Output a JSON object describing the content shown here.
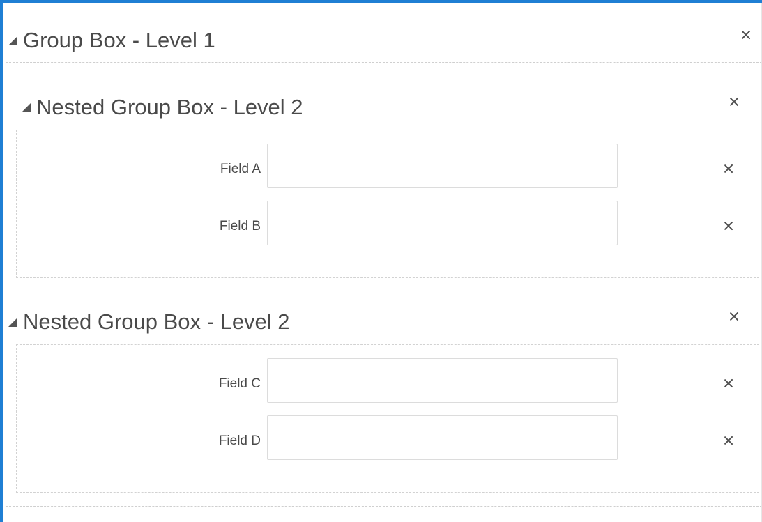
{
  "group_box": {
    "title": "Group Box - Level 1",
    "nested": [
      {
        "title": "Nested Group Box - Level 2",
        "fields": [
          {
            "label": "Field A",
            "value": ""
          },
          {
            "label": "Field B",
            "value": ""
          }
        ]
      },
      {
        "title": "Nested Group Box - Level 2",
        "fields": [
          {
            "label": "Field C",
            "value": ""
          },
          {
            "label": "Field D",
            "value": ""
          }
        ]
      }
    ]
  },
  "icons": {
    "collapse": "triangle-collapse-icon",
    "close": "close-icon"
  },
  "colors": {
    "accent_border": "#1f7fd4",
    "text": "#4a4a4a",
    "dashed": "#cfcfcf"
  }
}
